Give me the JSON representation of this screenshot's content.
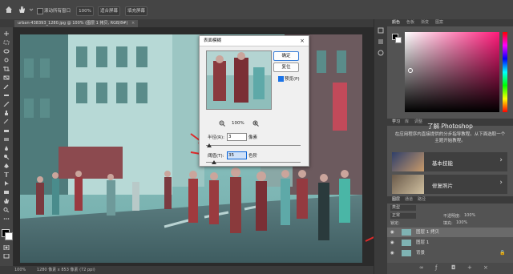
{
  "options_bar": {
    "scroll_all_label": "滚动所有窗口",
    "zoom_value": "100%",
    "fit_screen_label": "适合屏幕",
    "fill_screen_label": "填充屏幕"
  },
  "document": {
    "tab_title": "urban-438393_1280.jpg @ 100% (图层 1 拷贝, RGB/8#)",
    "status_zoom": "100%",
    "status_size": "1280 像素 x 853 像素 (72 ppi)"
  },
  "dialog": {
    "title": "表面模糊",
    "ok_label": "确定",
    "reset_label": "复位",
    "preview_label": "预览(P)",
    "preview_checked": true,
    "zoom_value": "100%",
    "radius_label": "半径(R):",
    "radius_value": "3",
    "radius_unit": "像素",
    "threshold_label": "阈值(T):",
    "threshold_value": "35",
    "threshold_unit": "色阶"
  },
  "panels": {
    "color_tabs": [
      "颜色",
      "色板",
      "渐变",
      "图案"
    ],
    "learn_tabs": [
      "学习",
      "库",
      "调整"
    ],
    "learn_title": "了解 Photoshop",
    "learn_desc": "在应用程序内直接提供的分步指导教程。从下面选取一个主题开始教程。",
    "learn_items": [
      {
        "label": "基本技能"
      },
      {
        "label": "修复照片"
      }
    ],
    "layer_tabs": [
      "图层",
      "通道",
      "路径"
    ],
    "layer_kind": "类型",
    "layer_mode": "正常",
    "layer_opacity_label": "不透明度:",
    "layer_opacity": "100%",
    "layer_lock_label": "锁定:",
    "layer_fill_label": "填充:",
    "layer_fill": "100%",
    "layers": [
      {
        "name": "图层 1 拷贝",
        "selected": true
      },
      {
        "name": "图层 1",
        "selected": false
      },
      {
        "name": "背景",
        "selected": false
      }
    ]
  },
  "colors": {
    "accent_arrow": "#e02a2a",
    "selected_layer": "#6a6a6a",
    "field_focus": "#0a64d8"
  }
}
